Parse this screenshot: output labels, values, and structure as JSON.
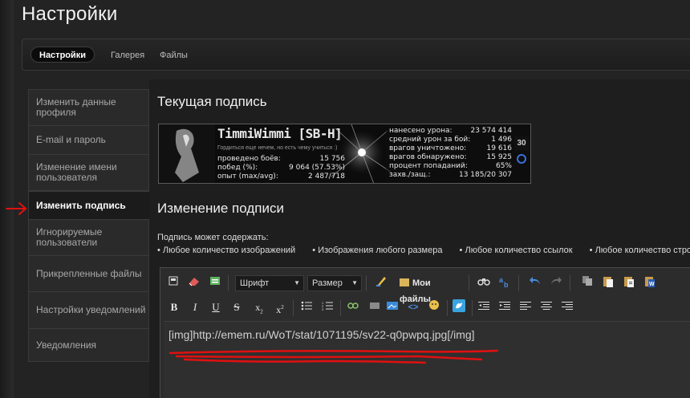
{
  "page": {
    "title": "Настройки"
  },
  "navbar": {
    "tabs": [
      "Настройки",
      "Галерея",
      "Файлы"
    ]
  },
  "sidebar": {
    "items": [
      "Изменить данные профиля",
      "E-mail и пароль",
      "Изменение имени пользователя",
      "Изменить подпись",
      "Игнорируемые пользователи",
      "Прикрепленные файлы",
      "Настройки уведомлений",
      "Уведомления"
    ]
  },
  "current_signature": {
    "heading": "Текущая подпись",
    "nick": "TimmiWimmi [SB-H]",
    "subtitle": "Гордиться еще нечем, но есть чему учиться :)",
    "left_stats": [
      {
        "label": "проведено боёв:",
        "value": "15 756"
      },
      {
        "label": "побед (%):",
        "value": "9 064 (57.53%)"
      },
      {
        "label": "опыт (max/avg):",
        "value": "2 487/718"
      }
    ],
    "right_stats": [
      {
        "label": "нанесено урона:",
        "value": "23 574 414"
      },
      {
        "label": "средний урон за бой:",
        "value": "1 496"
      },
      {
        "label": "врагов уничтожено:",
        "value": "19 616"
      },
      {
        "label": "врагов обнаружено:",
        "value": "15 925"
      },
      {
        "label": "процент попаданий:",
        "value": "65%"
      },
      {
        "label": "захв./защ.:",
        "value": "13 185/20 307"
      }
    ],
    "badge": "30"
  },
  "edit_signature": {
    "heading": "Изменение подписи",
    "may_contain": "Подпись может содержать:",
    "bullets": [
      "Любое количество изображений",
      "Изображения любого размера",
      "Любое количество ссылок",
      "Любое количество строк"
    ]
  },
  "editor": {
    "font_select": "Шрифт",
    "size_select": "Размер",
    "my_files_label": "Мои файлы",
    "content": "[img]http://emem.ru/WoT/stat/1071195/sv22-q0pwpq.jpg[/img]"
  },
  "colors": {
    "annotation_red": "#e01010",
    "accent_blue": "#2a7ad8"
  }
}
